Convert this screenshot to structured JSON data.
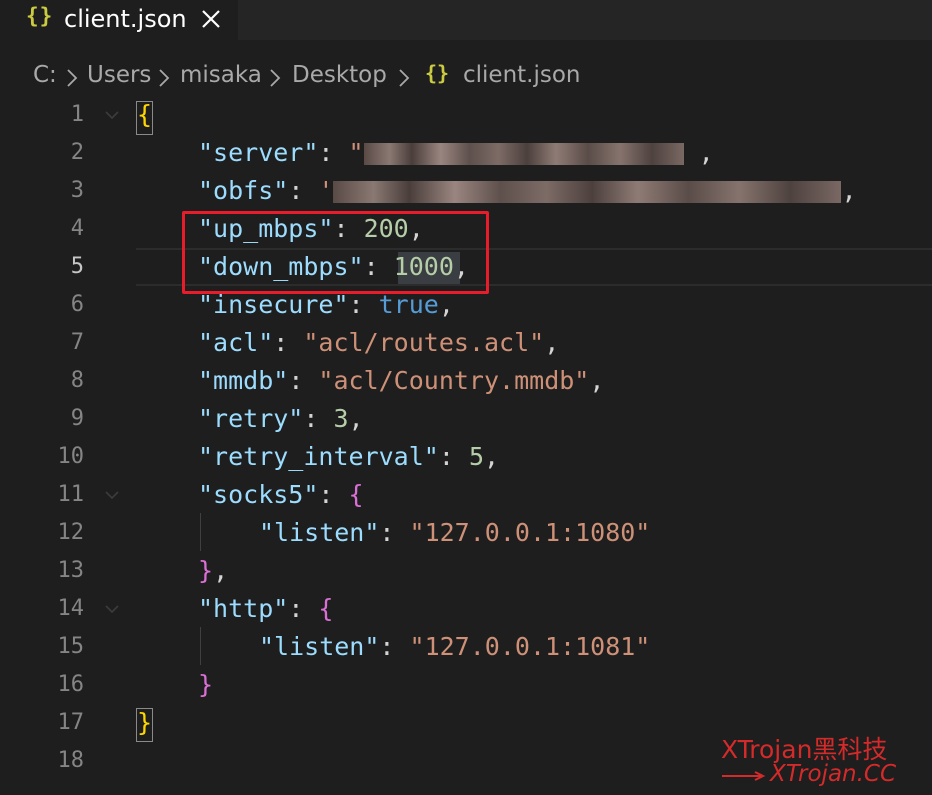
{
  "tab": {
    "icon": "json-braces-icon",
    "icon_text": "{}",
    "label": "client.json",
    "close_icon": "close-icon"
  },
  "breadcrumb": {
    "items": [
      "C:",
      "Users",
      "misaka",
      "Desktop"
    ],
    "file_icon_text": "{}",
    "file": "client.json"
  },
  "editor": {
    "active_line": 5,
    "line_numbers": [
      "1",
      "2",
      "3",
      "4",
      "5",
      "6",
      "7",
      "8",
      "9",
      "10",
      "11",
      "12",
      "13",
      "14",
      "15",
      "16",
      "17",
      "18"
    ],
    "keys": {
      "server": "\"server\"",
      "obfs": "\"obfs\"",
      "up_mbps": "\"up_mbps\"",
      "down_mbps": "\"down_mbps\"",
      "insecure": "\"insecure\"",
      "acl": "\"acl\"",
      "mmdb": "\"mmdb\"",
      "retry": "\"retry\"",
      "retry_interval": "\"retry_interval\"",
      "socks5": "\"socks5\"",
      "listen1": "\"listen\"",
      "http": "\"http\"",
      "listen2": "\"listen\""
    },
    "values": {
      "up_mbps": "200",
      "down_mbps": "1000",
      "insecure": "true",
      "acl": "\"acl/routes.acl\"",
      "mmdb": "\"acl/Country.mmdb\"",
      "retry": "3",
      "retry_interval": "5",
      "socks5_listen": "\"127.0.0.1:1080\"",
      "http_listen": "\"127.0.0.1:1081\""
    }
  },
  "watermark": {
    "line1": "XTrojan黑科技",
    "line2": "XTrojan.CC"
  },
  "colors": {
    "highlight_box": "#e81c2a",
    "key": "#9cdcfe",
    "string": "#ce9178",
    "number": "#b5cea8",
    "keyword": "#569cd6"
  }
}
